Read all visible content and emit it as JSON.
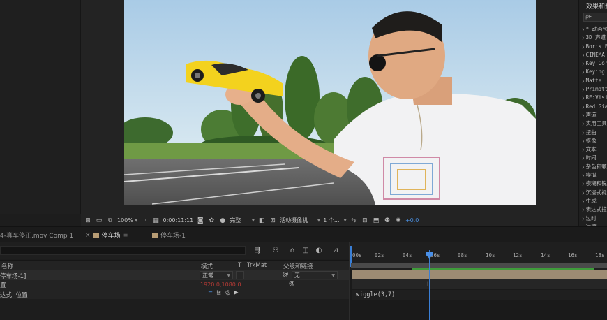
{
  "viewer": {
    "zoom": "100%",
    "timecode": "0:00:11:11",
    "resolution": "完整",
    "camera": "活动摄像机",
    "views": "1 个...",
    "exposure": "+0.0"
  },
  "effects_panel": {
    "title": "效果和预设",
    "search_placeholder": "ρ▸",
    "items": [
      "* 动画预设",
      "3D 声道",
      "Boris FX",
      "CINEMA 4D",
      "Key Corr",
      "Keying",
      "Matte",
      "Primatte",
      "RE:Vision",
      "Red Giant",
      "声道",
      "实用工具",
      "扭曲",
      "抠像",
      "文本",
      "时间",
      "杂色和颗粒",
      "模拟",
      "模糊和锐化",
      "沉浸式视频",
      "生成",
      "表达式控制",
      "过时",
      "过渡"
    ]
  },
  "tabs": [
    {
      "label": "4-真车停正.mov Comp 1",
      "active": false
    },
    {
      "label": "停车场",
      "active": true
    },
    {
      "label": "停车场-1",
      "active": false
    }
  ],
  "timeline": {
    "ruler_ticks": [
      "00s",
      "02s",
      "04s",
      "06s",
      "08s",
      "10s",
      "12s",
      "14s",
      "16s",
      "18s"
    ],
    "columns": {
      "name": "名称",
      "mode": "模式",
      "t": "T",
      "trkmat": "TrkMat",
      "parent": "父级和链接"
    },
    "layer": {
      "name": "停车场-1]",
      "mode": "正常",
      "parent": "无",
      "position_label": "置",
      "position_value": "1920.0,1080.0",
      "expression_label": "达式: 位置",
      "expression": "wiggle(3,7)"
    }
  },
  "colors": {
    "accent_blue": "#3a7fd6",
    "layer_label": "#b79c74",
    "work_green": "#3f9b3b",
    "marker_red": "#c43a32"
  }
}
